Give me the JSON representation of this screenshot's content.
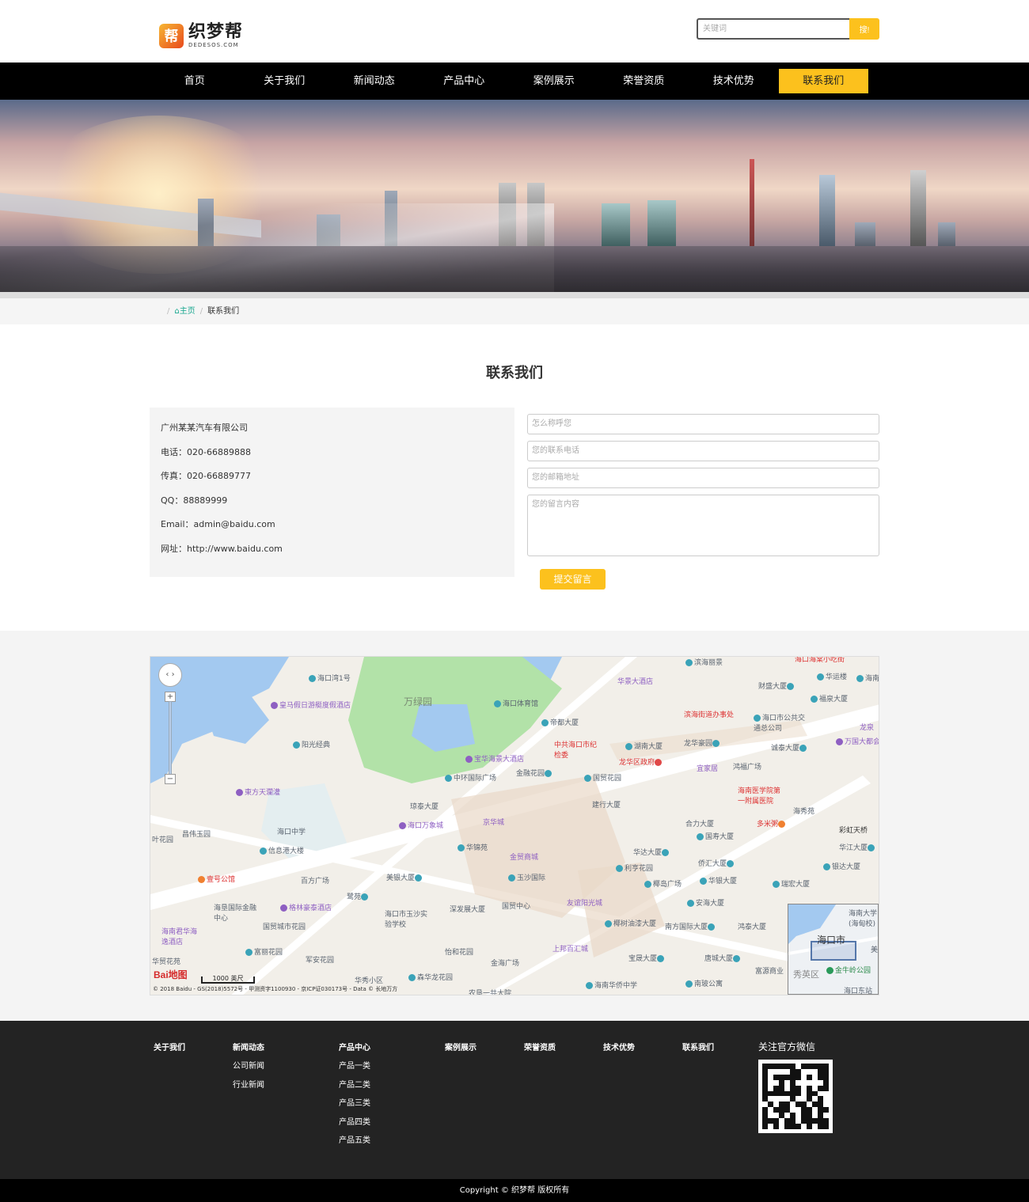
{
  "header": {
    "logo_badge": "帮",
    "logo_cn": "织梦帮",
    "logo_en": "DEDESOS.COM",
    "search_placeholder": "关键词",
    "search_button": "搜!"
  },
  "nav": {
    "items": [
      "首页",
      "关于我们",
      "新闻动态",
      "产品中心",
      "案例展示",
      "荣誉资质",
      "技术优势",
      "联系我们"
    ],
    "active_index": 7
  },
  "breadcrumb": {
    "home": "主页",
    "current": "联系我们"
  },
  "contact": {
    "title": "联系我们",
    "company": "广州某某汽车有限公司",
    "phone": "电话：020-66889888",
    "fax": "传真：020-66889777",
    "qq": "QQ：88889999",
    "email": "Email：admin@baidu.com",
    "website": "网址：http://www.baidu.com",
    "form": {
      "name_placeholder": "怎么称呼您",
      "phone_placeholder": "您的联系电话",
      "email_placeholder": "您的邮箱地址",
      "message_placeholder": "您的留言内容",
      "submit": "提交留言"
    }
  },
  "map": {
    "labels": {
      "wanlvyuan": "万绿园",
      "haikou_bay1": "海口湾1号",
      "huangma": "皇马假日游艇度假酒店",
      "yangguang": "阳光经典",
      "dongfang": "東方天瀾灌",
      "haikou_zx": "海口中学",
      "changwei": "昌伟玉园",
      "yehuayuan": "叶花园",
      "xinxigang": "信息港大楼",
      "yihao": "壹号公馆",
      "baifang": "百方广场",
      "haiken": "海垦国际金融中心",
      "gelin": "格林豪泰酒店",
      "guomao_hy": "国贸城市花园",
      "junhua": "海南君华海逸酒店",
      "fuli": "富丽花园",
      "junan": "军安花园",
      "huamao_hy": "华贸花苑",
      "huaxiu": "华秀小区",
      "senhualong": "森华龙花园",
      "nongken": "农垦一共大院",
      "tiyuguan": "海口体育馆",
      "dihdu": "帝都大厦",
      "baohua": "宝华海景大酒店",
      "zhonghuan": "中环国际广场",
      "jinrong": "金融花园",
      "qiongtai": "琼泰大厦",
      "wanxiang": "海口万象城",
      "jinghua": "京华城",
      "huajin": "华锦苑",
      "jinmao": "金贸商城",
      "yulan": "玉沙国际",
      "meiyin": "美银大厦",
      "yuanyuan": "鹭苑",
      "yusha_xx": "海口市玉沙实验学校",
      "shenfa": "深发展大厦",
      "guomao_zx": "国贸中心",
      "yihe": "怡和花园",
      "jinhai": "金海广场",
      "shangbang": "上邦百汇城",
      "youyi": "友谊阳光城",
      "yeshu": "椰树油漆大厦",
      "huanan_hq": "海南华侨中学",
      "huajing": "华景大酒店",
      "zhongong": "中共海口市纪检委",
      "hunan": "湖南大厦",
      "longhua_zf": "龙华区政府",
      "guomao_hy2": "国贸花园",
      "jianxing": "建行大厦",
      "binhai_jd": "滨海街道办事处",
      "longhua_hy": "龙华豪园",
      "yijiaju": "宜家居",
      "hongfu": "鸿福广场",
      "huayi": "海南医学院第一附属医院",
      "heli": "合力大厦",
      "guoshou": "国寿大厦",
      "duomi": "多米粥",
      "huada": "华达大厦",
      "lihen": "利亨花园",
      "qiaohui": "侨汇大厦",
      "yedao": "椰岛广场",
      "huayin": "华银大厦",
      "anhai": "安海大厦",
      "nanfang": "南方国际大厦",
      "hongtai": "鸿泰大厦",
      "baosheng": "宝晟大厦",
      "tangcheng": "唐城大厦",
      "nanbo": "南玻公寓",
      "fuyuan": "富源商业",
      "ruihong": "瑞宏大厦",
      "binhai_lj": "滨海丽景",
      "caisheng": "财盛大厦",
      "huayun": "华运楼",
      "haihan": "海南",
      "fuquan": "福泉大厦",
      "gonggong": "海口市公共交通总公司",
      "chengtai": "诚泰大厦",
      "wanguo": "万国大都会",
      "longquan": "龙泉",
      "haixiu": "海秀苑",
      "caihong": "彩虹天桥",
      "huajiang": "华江大厦",
      "yinda": "银达大厦",
      "haikou_sheng": "海口海棠小吃街",
      "scale": "1000 英尺",
      "baidu": "Bai地图",
      "copyright": "© 2018 Baidu - GS(2018)5572号 - 甲测资字1100930 - 京ICP证030173号 - Data © 长地万方",
      "ov_city": "海口市",
      "ov_district": "秀英区",
      "ov_jinniu": "金牛岭公园",
      "ov_dongzhan": "海口东站",
      "ov_nanda": "海南大学(海甸校)",
      "ov_mei": "美"
    }
  },
  "footer": {
    "cols": [
      {
        "h": "关于我们",
        "items": []
      },
      {
        "h": "新闻动态",
        "items": [
          "公司新闻",
          "行业新闻"
        ]
      },
      {
        "h": "产品中心",
        "items": [
          "产品一类",
          "产品二类",
          "产品三类",
          "产品四类",
          "产品五类"
        ]
      },
      {
        "h": "案例展示",
        "items": []
      },
      {
        "h": "荣誉资质",
        "items": []
      },
      {
        "h": "技术优势",
        "items": []
      },
      {
        "h": "联系我们",
        "items": []
      }
    ],
    "wechat_title": "关注官方微信",
    "copyright": "Copyright © 织梦帮 版权所有"
  },
  "colors": {
    "accent": "#fcc11d",
    "nav_bg": "#000000",
    "footer_bg": "#232323",
    "link": "#1aa890"
  }
}
